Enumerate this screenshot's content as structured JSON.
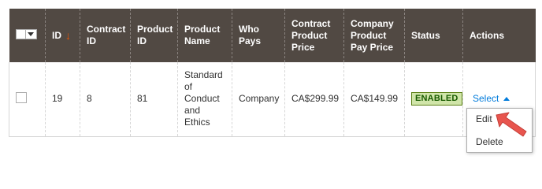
{
  "grid": {
    "columns": [
      {
        "key": "select",
        "label": ""
      },
      {
        "key": "id",
        "label": "ID",
        "sorted": "desc"
      },
      {
        "key": "contract_id",
        "label": "Contract ID"
      },
      {
        "key": "product_id",
        "label": "Product ID"
      },
      {
        "key": "product_name",
        "label": "Product Name"
      },
      {
        "key": "who_pays",
        "label": "Who Pays"
      },
      {
        "key": "contract_product_price",
        "label": "Contract Product Price"
      },
      {
        "key": "company_product_pay_price",
        "label": "Company Product Pay Price"
      },
      {
        "key": "status",
        "label": "Status"
      },
      {
        "key": "actions",
        "label": "Actions"
      }
    ],
    "sort_arrow": "↓",
    "rows": [
      {
        "id": "19",
        "contract_id": "8",
        "product_id": "81",
        "product_name": "Standard of Conduct and Ethics",
        "who_pays": "Company",
        "contract_product_price": "CA$299.99",
        "company_product_pay_price": "CA$149.99",
        "status": "ENABLED",
        "actions_label": "Select",
        "checked": false
      }
    ]
  },
  "actions_menu": {
    "open": true,
    "items": [
      {
        "label": "Edit"
      },
      {
        "label": "Delete"
      }
    ]
  },
  "colors": {
    "header_bg": "#514943",
    "link": "#007bdb",
    "badge_bg": "#d0e5a9",
    "badge_border": "#5b8116",
    "sort_arrow": "#eb5202",
    "pointer_arrow": "#e8554e"
  },
  "icons": {
    "sort": "arrow-down-icon",
    "actions_toggle": "caret-up-icon",
    "mass_select": "chevron-down-icon",
    "annotation": "pointer-arrow-icon"
  }
}
